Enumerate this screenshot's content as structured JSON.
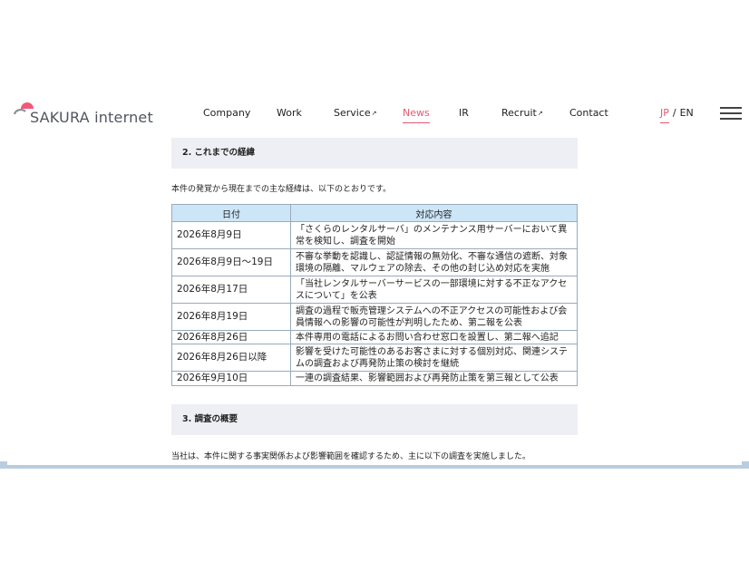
{
  "header": {
    "logo_text": "SAKURA internet",
    "nav": [
      {
        "label": "Company",
        "external": false,
        "active": false
      },
      {
        "label": "Work",
        "external": false,
        "active": false
      },
      {
        "label": "Service",
        "external": true,
        "active": false
      },
      {
        "label": "News",
        "external": false,
        "active": true
      },
      {
        "label": "IR",
        "external": false,
        "active": false
      },
      {
        "label": "Recruit",
        "external": true,
        "active": false
      },
      {
        "label": "Contact",
        "external": false,
        "active": false
      }
    ],
    "lang": {
      "jp": "JP",
      "sep": "/",
      "en": "EN"
    },
    "external_arrow": "↗"
  },
  "section2": {
    "title": "2. これまでの経緯",
    "intro": "本件の発覚から現在までの主な経緯は、以下のとおりです。",
    "table": {
      "headers": [
        "日付",
        "対応内容"
      ],
      "rows": [
        {
          "date": "2026年8月9日",
          "action": "「さくらのレンタルサーバ」のメンテナンス用サーバーにおいて異常を検知し、調査を開始"
        },
        {
          "date": "2026年8月9日～19日",
          "action": "不審な挙動を認識し、認証情報の無効化、不審な通信の遮断、対象環境の隔離、マルウェアの除去、その他の封じ込め対応を実施"
        },
        {
          "date": "2026年8月17日",
          "action": "「当社レンタルサーバーサービスの一部環境に対する不正なアクセスについて」を公表"
        },
        {
          "date": "2026年8月19日",
          "action": "調査の過程で販売管理システムへの不正アクセスの可能性および会員情報への影響の可能性が判明したため、第二報を公表"
        },
        {
          "date": "2026年8月26日",
          "action": "本件専用の電話によるお問い合わせ窓口を設置し、第二報へ追記"
        },
        {
          "date": "2026年8月26日以降",
          "action": "影響を受けた可能性のあるお客さまに対する個別対応、関連システムの調査および再発防止策の検討を継続"
        },
        {
          "date": "2026年9月10日",
          "action": "一連の調査結果、影響範囲および再発防止策を第三報として公表"
        }
      ]
    }
  },
  "section3": {
    "title": "3. 調査の概要",
    "intro": "当社は、本件に関する事実関係および影響範囲を確認するため、主に以下の調査を実施しました。"
  },
  "icons": {
    "logo_mark": "sakura-logo-icon",
    "menu": "hamburger-menu-icon"
  },
  "colors": {
    "accent": "#e5586f",
    "table_header": "#cde6f7",
    "section_bg": "#eeeff4"
  }
}
